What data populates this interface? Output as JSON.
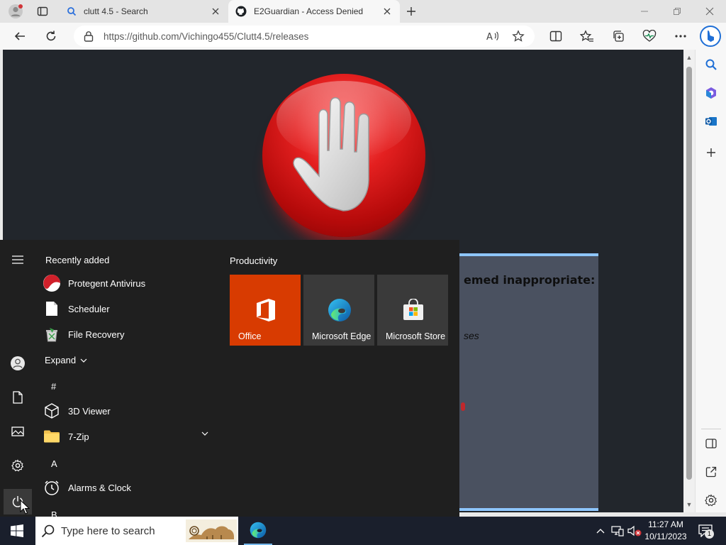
{
  "browser": {
    "tabs": [
      {
        "title": "clutt 4.5 - Search",
        "icon": "search-icon",
        "active": false
      },
      {
        "title": "E2Guardian - Access Denied",
        "icon": "github-icon",
        "active": true
      }
    ],
    "address": {
      "url": "https://github.com/Vichingo455/Clutt4.5/releases"
    }
  },
  "blocked_page": {
    "heading": "emed inappropriate:",
    "sub_text": "ses"
  },
  "start_menu": {
    "recently_added_label": "Recently added",
    "recent_apps": [
      {
        "name": "Protegent Antivirus",
        "icon": "protegent-icon"
      },
      {
        "name": "Scheduler",
        "icon": "document-icon"
      },
      {
        "name": "File Recovery",
        "icon": "file-recovery-icon"
      }
    ],
    "expand_label": "Expand",
    "groups": [
      {
        "letter": "#",
        "apps": [
          {
            "name": "3D Viewer",
            "icon": "cube-icon"
          },
          {
            "name": "7-Zip",
            "icon": "folder-icon",
            "expandable": true
          }
        ]
      },
      {
        "letter": "A",
        "apps": [
          {
            "name": "Alarms & Clock",
            "icon": "clock-icon"
          }
        ]
      },
      {
        "letter": "B",
        "apps": []
      }
    ],
    "tiles_group_label": "Productivity",
    "tiles": [
      {
        "label": "Office",
        "icon": "office-icon",
        "color": "#d83b01"
      },
      {
        "label": "Microsoft Edge",
        "icon": "edge-icon",
        "color": "#3a3a3a"
      },
      {
        "label": "Microsoft Store",
        "icon": "store-icon",
        "color": "#3a3a3a"
      }
    ]
  },
  "taskbar": {
    "search_placeholder": "Type here to search",
    "time": "11:27 AM",
    "date": "10/11/2023",
    "notification_count": "1"
  }
}
